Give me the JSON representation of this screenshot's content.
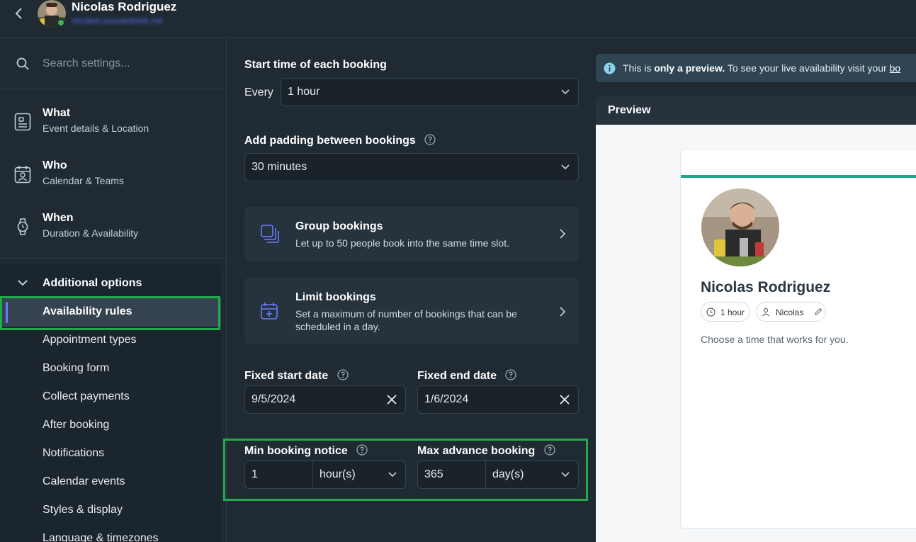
{
  "header": {
    "user_name": "Nicolas Rodriguez",
    "user_email": "nicolasr.youcanbook.me"
  },
  "sidebar": {
    "search_placeholder": "Search settings...",
    "nav": [
      {
        "title": "What",
        "sub": "Event details & Location",
        "icon": "document-list-icon"
      },
      {
        "title": "Who",
        "sub": "Calendar & Teams",
        "icon": "calendar-person-icon"
      },
      {
        "title": "When",
        "sub": "Duration & Availability",
        "icon": "watch-icon"
      }
    ],
    "additional_title": "Additional options",
    "options": [
      "Availability rules",
      "Appointment types",
      "Booking form",
      "Collect payments",
      "After booking",
      "Notifications",
      "Calendar events",
      "Styles & display",
      "Language & timezones"
    ],
    "active_option": "Availability rules"
  },
  "form": {
    "start_time_label": "Start time of each booking",
    "every_label": "Every",
    "every_value": "1 hour",
    "padding_label": "Add padding between bookings",
    "padding_value": "30 minutes",
    "group_title": "Group bookings",
    "group_desc": "Let up to 50 people book into the same time slot.",
    "limit_title": "Limit bookings",
    "limit_desc": "Set a maximum of number of bookings that can be scheduled in a day.",
    "fixed_start_label": "Fixed start date",
    "fixed_start_value": "9/5/2024",
    "fixed_end_label": "Fixed end date",
    "fixed_end_value": "1/6/2024",
    "min_notice_label": "Min booking notice",
    "min_notice_value": "1",
    "min_notice_unit": "hour(s)",
    "max_advance_label": "Max advance booking",
    "max_advance_value": "365",
    "max_advance_unit": "day(s)"
  },
  "preview": {
    "info_prefix": "This is ",
    "info_bold": "only a preview.",
    "info_suffix": " To see your live availability visit your ",
    "info_link": "bo",
    "title": "Preview",
    "name": "Nicolas Rodriguez",
    "duration_chip": "1 hour",
    "host_chip": "Nicolas",
    "prompt": "Choose a time that works for you."
  },
  "colors": {
    "background": "#1f2a33",
    "highlight": "#22a94a",
    "accent": "#6a7cff",
    "preview_bar": "#1fa38d"
  }
}
